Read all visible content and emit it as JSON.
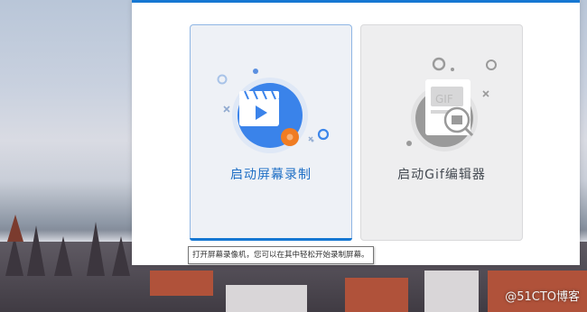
{
  "cards": [
    {
      "label": "启动屏幕录制",
      "state": "hovered"
    },
    {
      "label": "启动Gif编辑器",
      "state": "normal"
    }
  ],
  "tooltip": {
    "text": "打开屏幕录像机，您可以在其中轻松开始录制屏幕。"
  },
  "watermark": {
    "text": "@51CTO博客"
  },
  "icons": {
    "record": "video-camera-icon",
    "gif": "gif-editor-icon"
  },
  "colors": {
    "accent": "#1677d2",
    "record_badge": "#f07c22",
    "gif_gray": "#9a9a9a"
  }
}
